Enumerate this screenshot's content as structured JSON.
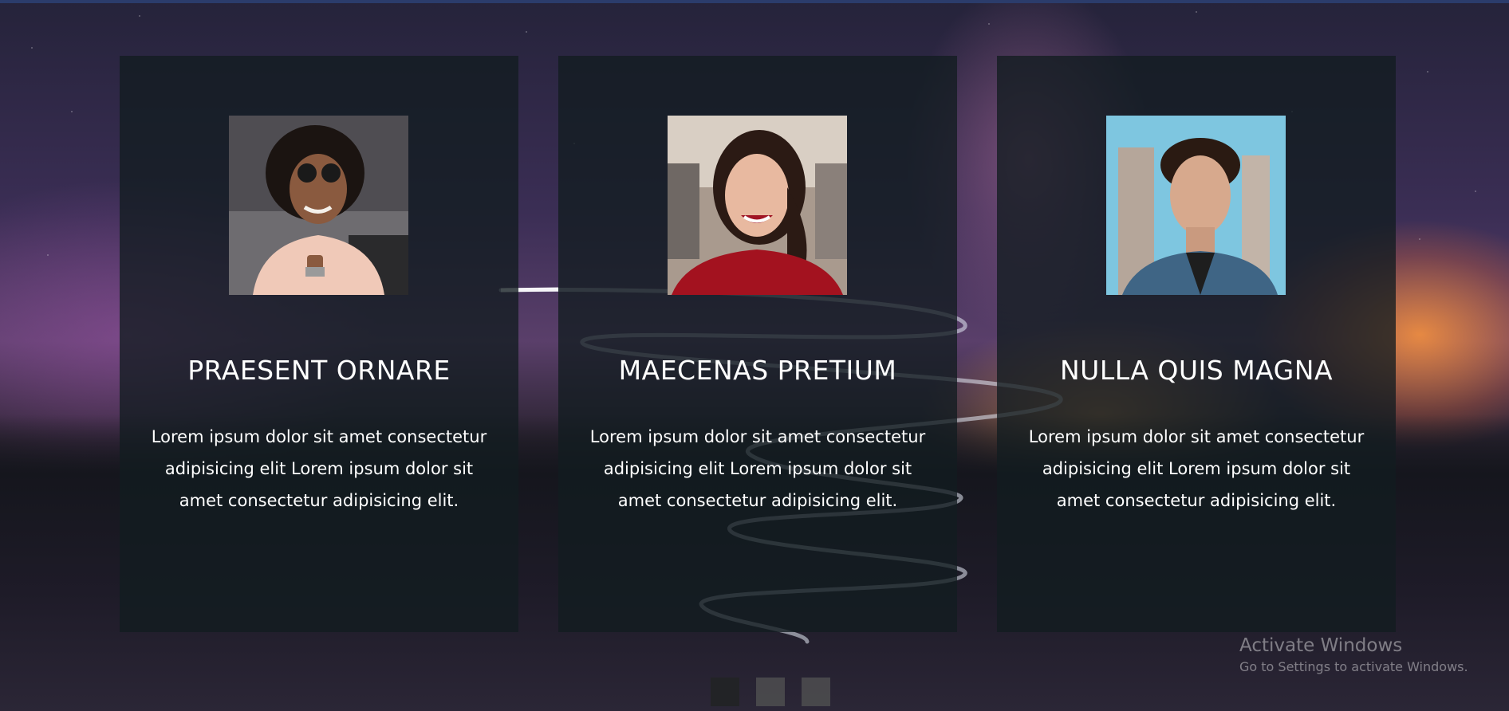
{
  "cards": [
    {
      "title": "PRAESENT ORNARE",
      "text": "Lorem ipsum dolor sit amet consectetur adipisicing elit Lorem ipsum dolor sit amet consectetur adipisicing elit."
    },
    {
      "title": "MAECENAS PRETIUM",
      "text": "Lorem ipsum dolor sit amet consectetur adipisicing elit Lorem ipsum dolor sit amet consectetur adipisicing elit."
    },
    {
      "title": "NULLA QUIS MAGNA",
      "text": "Lorem ipsum dolor sit amet consectetur adipisicing elit Lorem ipsum dolor sit amet consectetur adipisicing elit."
    }
  ],
  "pagination": {
    "pages": 3,
    "active_page": 1
  },
  "watermark": {
    "title": "Activate Windows",
    "subtitle": "Go to Settings to activate Windows."
  },
  "colors": {
    "card_background": "#121c20",
    "text": "#ffffff",
    "active_dot": "#222326",
    "inactive_dot": "#4a4a4d"
  }
}
